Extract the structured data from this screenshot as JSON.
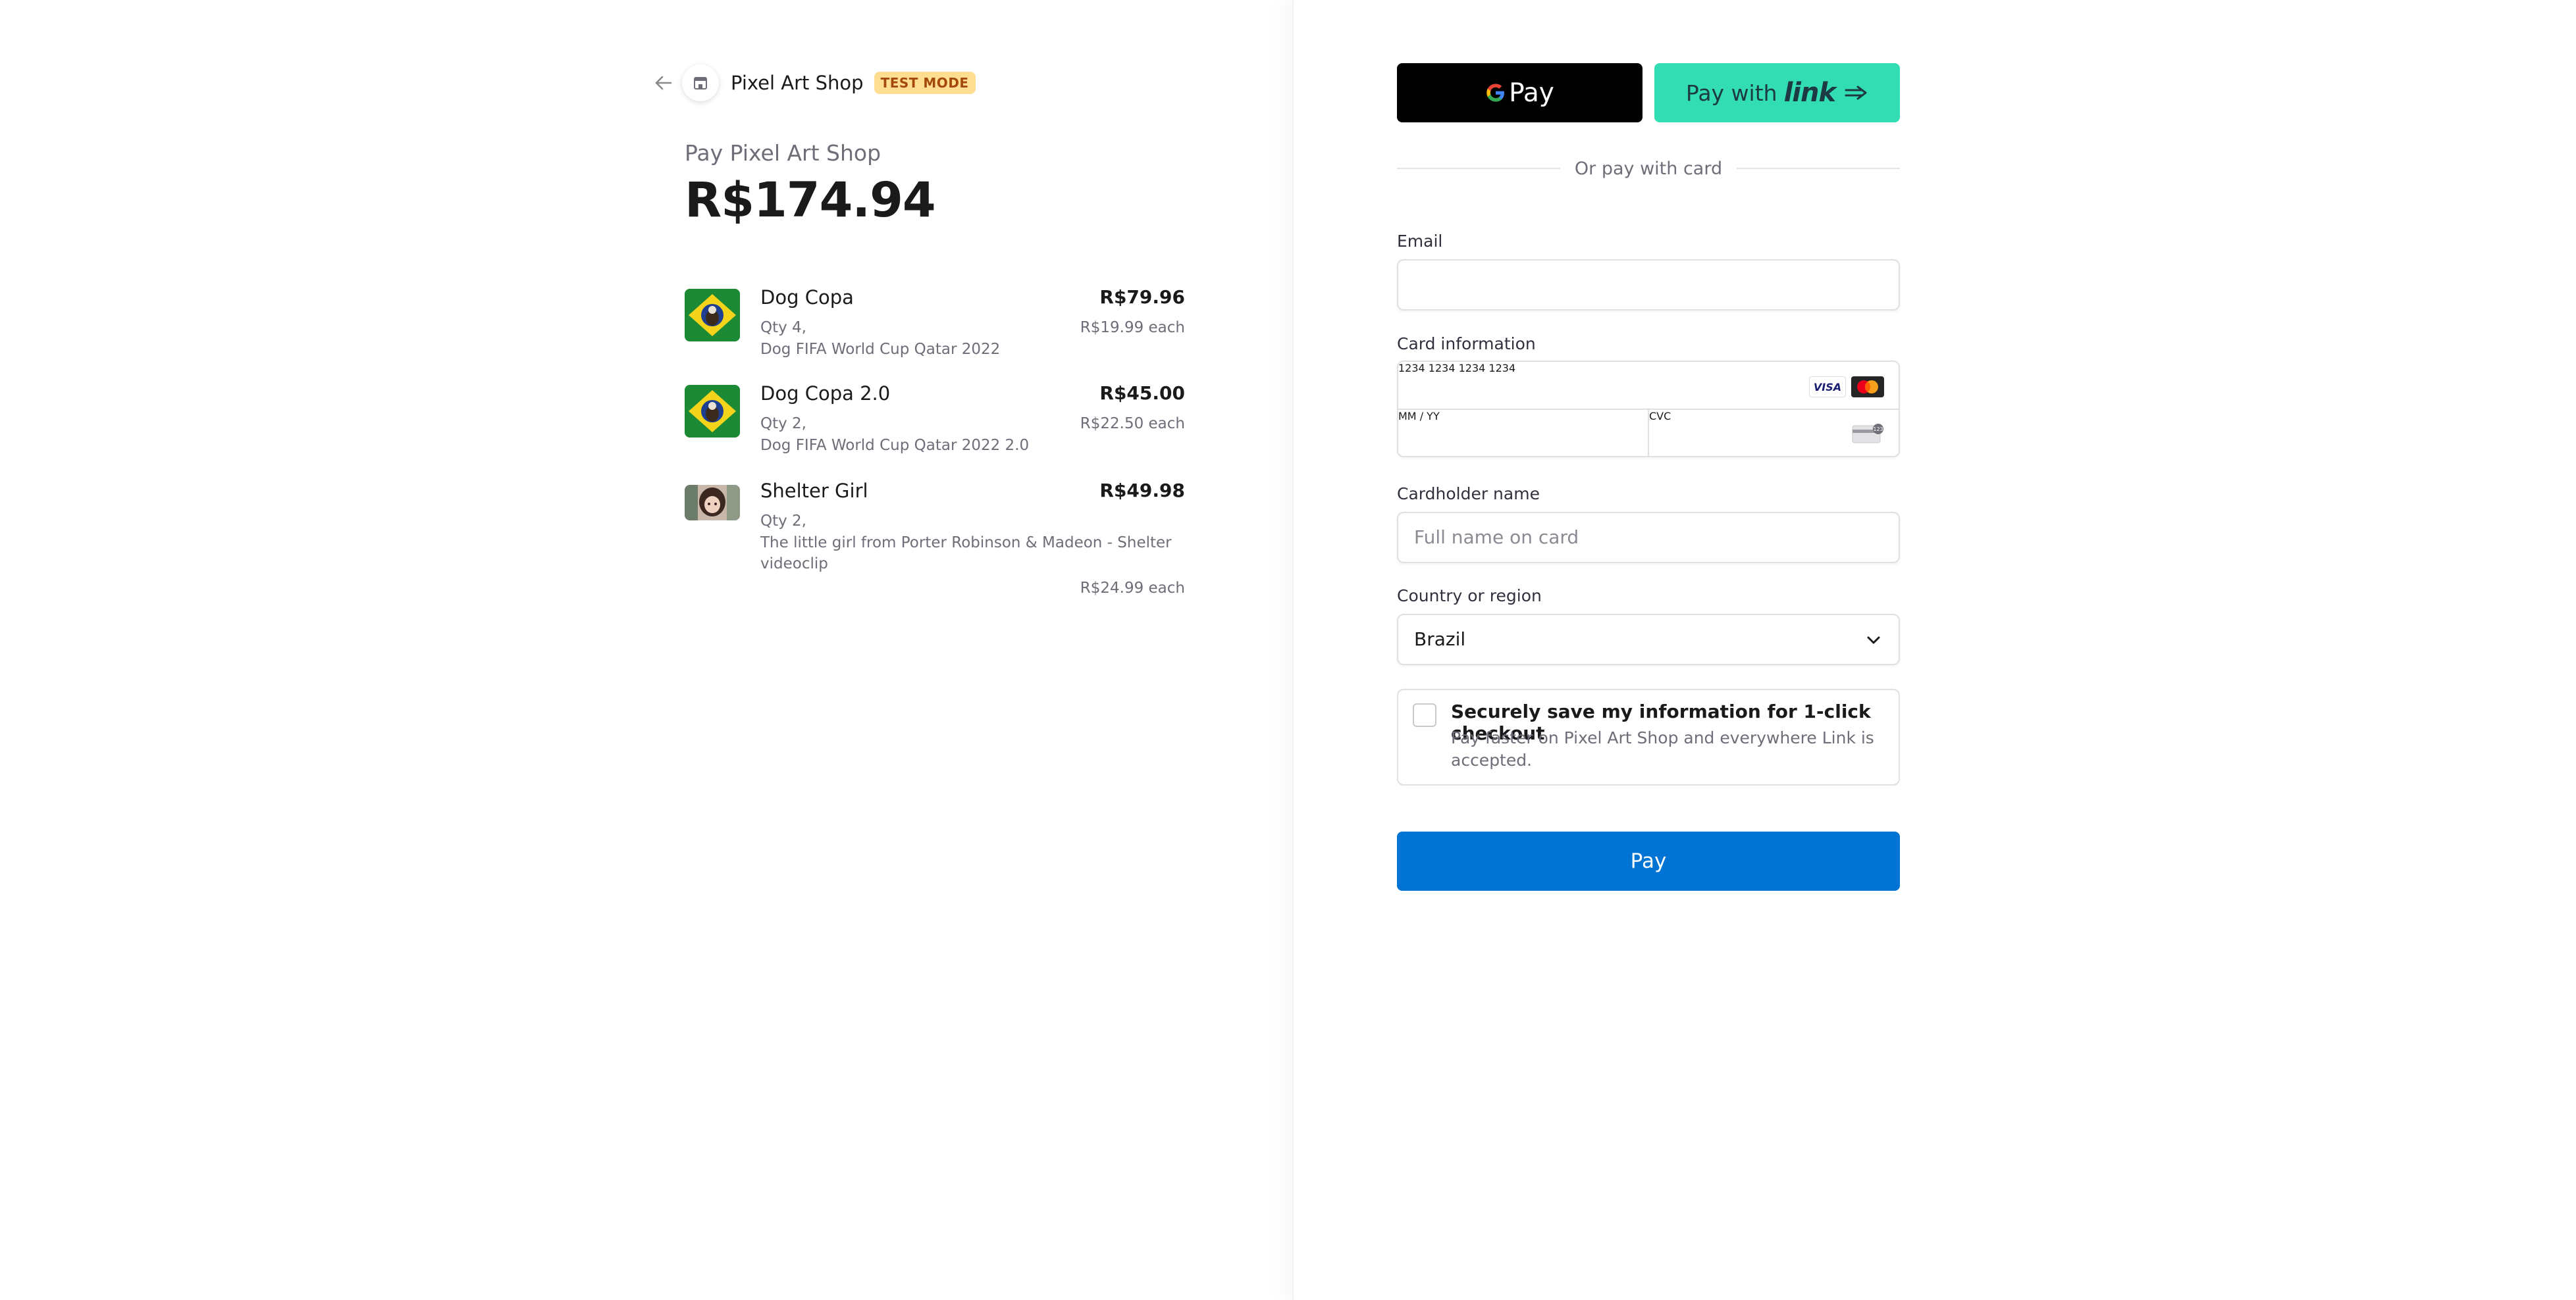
{
  "header": {
    "shop_name": "Pixel Art Shop",
    "test_badge": "TEST MODE"
  },
  "summary": {
    "pay_label": "Pay Pixel Art Shop",
    "total": "R$174.94"
  },
  "items": [
    {
      "name": "Dog Copa",
      "price": "R$79.96",
      "qty": "Qty 4,",
      "description": "Dog FIFA World Cup Qatar 2022",
      "each": "R$19.99 each"
    },
    {
      "name": "Dog Copa 2.0",
      "price": "R$45.00",
      "qty": "Qty 2,",
      "description": "Dog FIFA World Cup Qatar 2022 2.0",
      "each": "R$22.50 each"
    },
    {
      "name": "Shelter Girl",
      "price": "R$49.98",
      "qty": "Qty 2,",
      "description": "The little girl from Porter Robinson & Madeon - Shelter videoclip",
      "each": "R$24.99 each"
    }
  ],
  "wallets": {
    "gpay_label": "Pay",
    "link_label": "Pay with",
    "link_logo": "link"
  },
  "divider_text": "Or pay with card",
  "form": {
    "email_label": "Email",
    "email_value": "",
    "card_label": "Card information",
    "card_number_placeholder": "1234 1234 1234 1234",
    "expiry_placeholder": "MM / YY",
    "cvc_placeholder": "CVC",
    "visa_text": "VISA",
    "cardholder_label": "Cardholder name",
    "cardholder_placeholder": "Full name on card",
    "country_label": "Country or region",
    "country_value": "Brazil"
  },
  "save_info": {
    "title": "Securely save my information for 1-click checkout",
    "subtitle": "Pay faster on Pixel Art Shop and everywhere Link is accepted."
  },
  "pay_button": "Pay",
  "colors": {
    "pay_button": "#0074d4",
    "link_button": "#33ddb3",
    "gpay_button": "#000000",
    "test_badge_bg": "#ffde92",
    "test_badge_text": "#a4490b"
  }
}
